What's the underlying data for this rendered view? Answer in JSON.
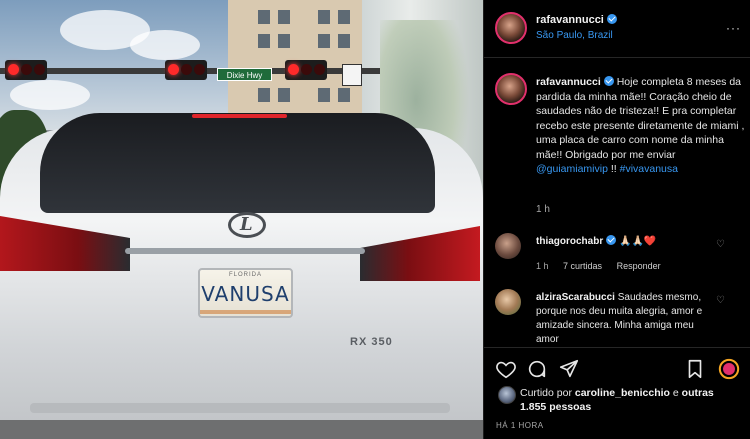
{
  "post": {
    "photo_plate_text": "VANUSA",
    "photo_plate_top": "FLORIDA",
    "photo_model_badge": "RX 350",
    "street_sign": "Dixie Hwy"
  },
  "header": {
    "username": "rafavannucci",
    "location": "São Paulo, Brazil",
    "more": "···"
  },
  "caption": {
    "username": "rafavannucci",
    "text": "Hoje completa 8 meses da pardida da minha mãe!! Coração cheio de saudades não de tristeza!! E pra completar recebo este presente diretamente de miami , uma placa de carro com nome da minha mãe!! Obrigado por me enviar ",
    "mention": "@guiamiamivip",
    "separator": " !! ",
    "hashtag": "#vivavanusa",
    "time": "1 h"
  },
  "comments": [
    {
      "username": "thiagorochabr",
      "text": "🙏🏻🙏🏻❤️",
      "time": "1 h",
      "likes": "7 curtidas",
      "reply": "Responder"
    },
    {
      "username": "alziraScarabucci",
      "text": "Saudades mesmo, porque nos deu muita alegria, amor e amizade sincera. Minha amiga meu amor"
    }
  ],
  "likes": {
    "prefix": "Curtido por ",
    "user": "caroline_benicchio",
    "and": " e ",
    "others": "outras 1.855 pessoas"
  },
  "time_ago": "HÁ 1 HORA",
  "colors": {
    "link": "#3897f0",
    "verified": "#3897f0",
    "background": "#000000"
  }
}
